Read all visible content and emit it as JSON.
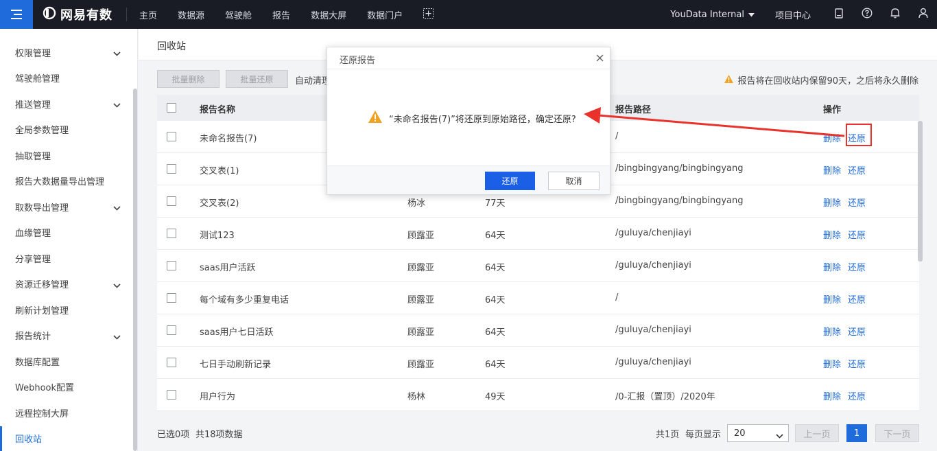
{
  "topbar": {
    "logo_text": "网易有数",
    "nav": [
      "主页",
      "数据源",
      "驾驶舱",
      "报告",
      "数据大屏",
      "数据门户"
    ],
    "org": "YouData Internal",
    "project_center": "项目中心"
  },
  "sidebar": {
    "items": [
      {
        "label": "权限管理",
        "has_chevron": true
      },
      {
        "label": "驾驶舱管理",
        "has_chevron": false
      },
      {
        "label": "推送管理",
        "has_chevron": true
      },
      {
        "label": "全局参数管理",
        "has_chevron": false
      },
      {
        "label": "抽取管理",
        "has_chevron": false
      },
      {
        "label": "报告大数据量导出管理",
        "has_chevron": false
      },
      {
        "label": "取数导出管理",
        "has_chevron": true
      },
      {
        "label": "血缘管理",
        "has_chevron": false
      },
      {
        "label": "分享管理",
        "has_chevron": false
      },
      {
        "label": "资源迁移管理",
        "has_chevron": true
      },
      {
        "label": "刷新计划管理",
        "has_chevron": false
      },
      {
        "label": "报告统计",
        "has_chevron": true
      },
      {
        "label": "数据库配置",
        "has_chevron": false
      },
      {
        "label": "Webhook配置",
        "has_chevron": false
      },
      {
        "label": "远程控制大屏",
        "has_chevron": false
      },
      {
        "label": "回收站",
        "has_chevron": false,
        "active": true
      }
    ]
  },
  "main": {
    "title": "回收站",
    "batch_delete": "批量删除",
    "batch_restore": "批量还原",
    "auto_clean": "自动清理",
    "retention_note": "报告将在回收站内保留90天，之后将永久删除"
  },
  "table": {
    "headers": {
      "name": "报告名称",
      "path": "报告路径",
      "actions": "操作"
    },
    "delete_label": "删除",
    "restore_label": "还原",
    "rows": [
      {
        "name": "未命名报告(7)",
        "owner": "",
        "days": "",
        "path": "/"
      },
      {
        "name": "交叉表(1)",
        "owner": "",
        "days": "",
        "path": "/bingbingyang/bingbingyang"
      },
      {
        "name": "交叉表(2)",
        "owner": "杨冰",
        "days": "77天",
        "path": "/bingbingyang/bingbingyang"
      },
      {
        "name": "测试123",
        "owner": "顾露亚",
        "days": "64天",
        "path": "/guluya/chenjiayi"
      },
      {
        "name": "saas用户活跃",
        "owner": "顾露亚",
        "days": "64天",
        "path": "/guluya/chenjiayi"
      },
      {
        "name": "每个域有多少重复电话",
        "owner": "顾露亚",
        "days": "64天",
        "path": "/"
      },
      {
        "name": "saas用户七日活跃",
        "owner": "顾露亚",
        "days": "64天",
        "path": "/guluya/chenjiayi"
      },
      {
        "name": "七日手动刷新记录",
        "owner": "顾露亚",
        "days": "64天",
        "path": "/guluya/chenjiayi"
      },
      {
        "name": "用户行为",
        "owner": "杨林",
        "days": "49天",
        "path": "/0-汇报（置顶）/2020年"
      }
    ]
  },
  "footer": {
    "selected": "已选0项",
    "total": "共18项数据",
    "pages": "共1页",
    "per_page_label": "每页显示",
    "per_page_value": "20",
    "prev": "上一页",
    "current_page": "1",
    "next": "下一页"
  },
  "dialog": {
    "title": "还原报告",
    "message": "“未命名报告(7)”将还原到原始路径，确定还原?",
    "confirm": "还原",
    "cancel": "取消"
  },
  "colors": {
    "topbar_bg": "#191c25",
    "accent": "#1f6bdc",
    "warning": "#f0a322",
    "annotation_red": "#e8322b"
  }
}
